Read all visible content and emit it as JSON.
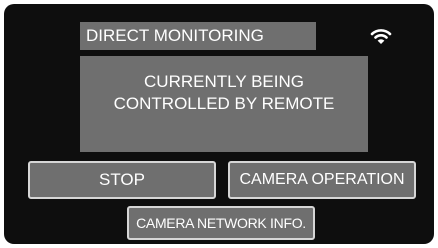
{
  "header": {
    "title": "DIRECT MONITORING",
    "wifi_icon": "wifi-icon"
  },
  "message": {
    "line1": "CURRENTLY BEING",
    "line2": "CONTROLLED BY REMOTE"
  },
  "buttons": {
    "stop_label": "STOP",
    "camera_operation_label": "CAMERA OPERATION",
    "camera_network_info_label": "CAMERA NETWORK INFO."
  },
  "colors": {
    "panel_background": "#0e0e0e",
    "box_gray": "#6f6f6f",
    "text": "#ffffff",
    "button_border": "#d6d6d6"
  }
}
